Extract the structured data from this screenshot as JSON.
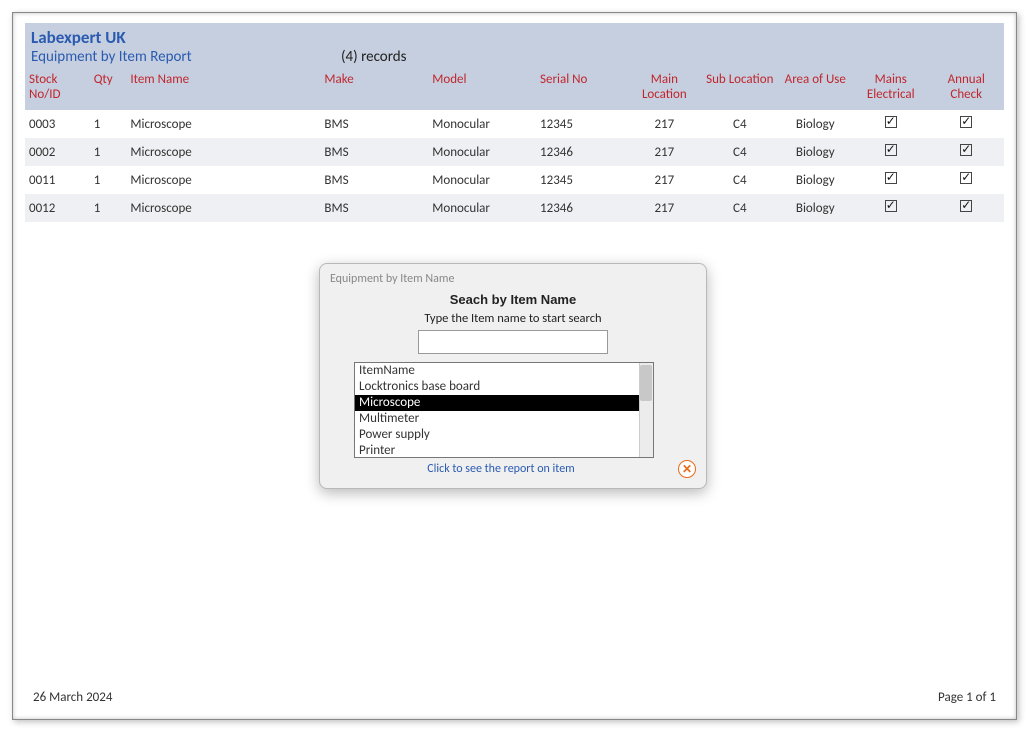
{
  "header": {
    "company": "Labexpert UK",
    "report_title": "Equipment by Item Report",
    "records_label": "(4) records"
  },
  "columns": {
    "stock": "Stock No/ID",
    "qty": "Qty",
    "name": "Item Name",
    "make": "Make",
    "model": "Model",
    "serial": "Serial No",
    "main_loc": "Main Location",
    "sub_loc": "Sub Location",
    "area": "Area of Use",
    "mains": "Mains Electrical",
    "annual": "Annual Check"
  },
  "rows": [
    {
      "stock": "0003",
      "qty": "1",
      "name": "Microscope",
      "make": "BMS",
      "model": "Monocular",
      "serial": "12345",
      "main_loc": "217",
      "sub_loc": "C4",
      "area": "Biology",
      "mains": true,
      "annual": true
    },
    {
      "stock": "0002",
      "qty": "1",
      "name": "Microscope",
      "make": "BMS",
      "model": "Monocular",
      "serial": "12346",
      "main_loc": "217",
      "sub_loc": "C4",
      "area": "Biology",
      "mains": true,
      "annual": true
    },
    {
      "stock": "0011",
      "qty": "1",
      "name": "Microscope",
      "make": "BMS",
      "model": "Monocular",
      "serial": "12345",
      "main_loc": "217",
      "sub_loc": "C4",
      "area": "Biology",
      "mains": true,
      "annual": true
    },
    {
      "stock": "0012",
      "qty": "1",
      "name": "Microscope",
      "make": "BMS",
      "model": "Monocular",
      "serial": "12346",
      "main_loc": "217",
      "sub_loc": "C4",
      "area": "Biology",
      "mains": true,
      "annual": true
    }
  ],
  "dialog": {
    "window_title": "Equipment by Item Name",
    "heading": "Seach by Item Name",
    "sub": "Type the Item name to start search",
    "input_value": "",
    "list_header": "ItemName",
    "items": [
      "Locktronics base board",
      "Microscope",
      "Multimeter",
      "Power supply",
      "Printer"
    ],
    "selected_index": 1,
    "hint": "Click to see the report on item",
    "close_label": "✕"
  },
  "footer": {
    "date": "26 March 2024",
    "page": "Page 1 of 1"
  }
}
